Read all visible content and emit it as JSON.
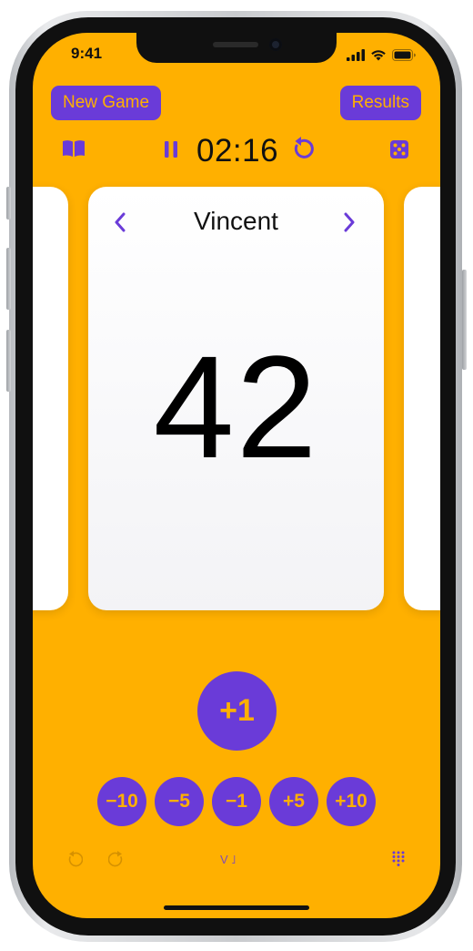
{
  "status_bar": {
    "time": "9:41",
    "icons": [
      "cellular-signal-icon",
      "wifi-icon",
      "battery-icon"
    ]
  },
  "header": {
    "new_game_label": "New Game",
    "results_label": "Results"
  },
  "toolbar": {
    "icons": [
      "book-icon",
      "pause-icon",
      "restart-timer-icon",
      "dice-icon"
    ],
    "timer": "02:16"
  },
  "player_card": {
    "name": "Vincent",
    "score": "42",
    "prev_icon": "chevron-left-icon",
    "next_icon": "chevron-right-icon"
  },
  "score_buttons": {
    "primary": "+1",
    "secondary": [
      "−10",
      "−5",
      "−1",
      "+5",
      "+10"
    ]
  },
  "bottom_bar": {
    "icons": [
      "undo-icon",
      "redo-icon",
      "sort-icon",
      "keypad-icon"
    ],
    "sort_label": "V ˩"
  },
  "colors": {
    "background": "#FFB000",
    "accent": "#6A3BD8",
    "card": "#FFFFFF",
    "text": "#111111"
  }
}
